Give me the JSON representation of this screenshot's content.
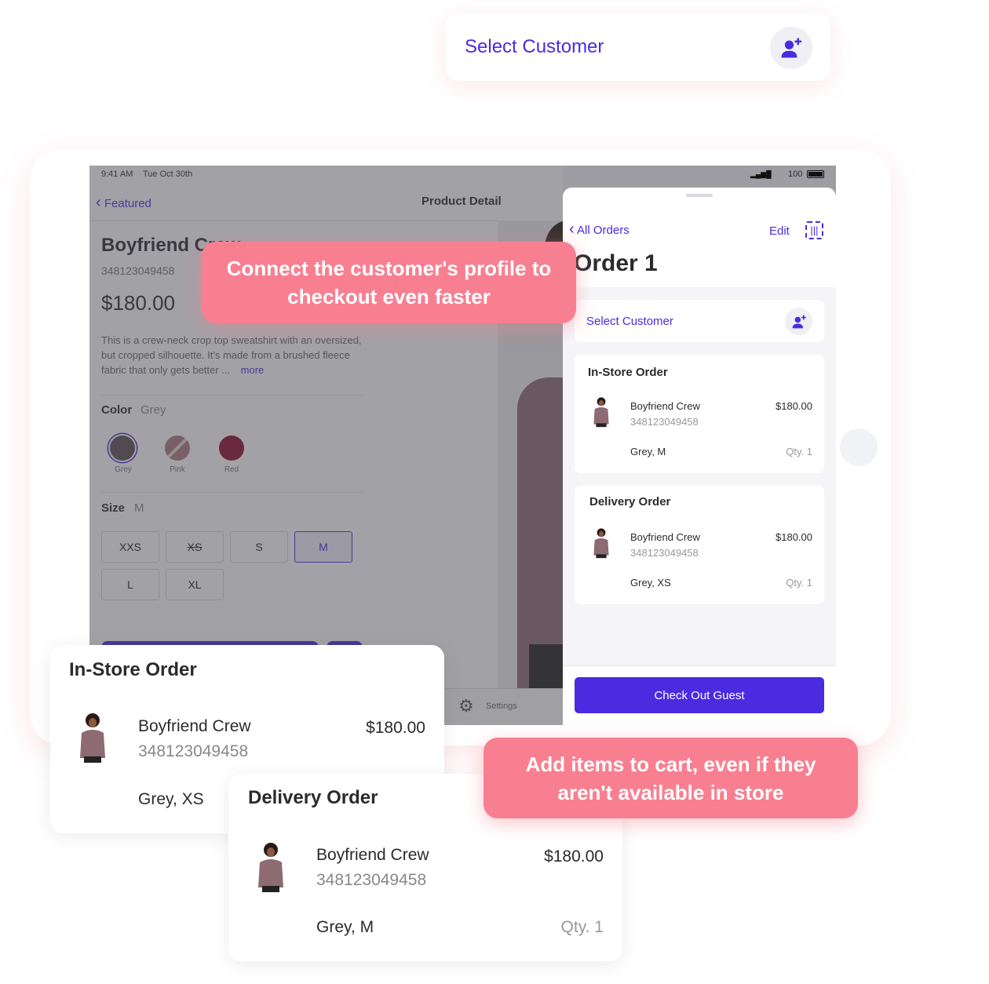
{
  "top_card": {
    "label": "Select Customer",
    "icon": "add-person-icon"
  },
  "status_bar": {
    "time": "9:41 AM",
    "date": "Tue Oct 30th",
    "battery": "100"
  },
  "nav": {
    "back_label": "Featured",
    "title": "Product Detail"
  },
  "product": {
    "name": "Boyfriend Crew",
    "sku": "348123049458",
    "price": "$180.00",
    "description": "This is a crew-neck crop top sweatshirt with an oversized, but cropped silhouette.  It's made from a brushed fleece fabric that only gets better ...",
    "more": "more",
    "color_label": "Color",
    "color_value": "Grey",
    "colors": [
      {
        "name": "Grey",
        "hex": "#5a4f55"
      },
      {
        "name": "Pink",
        "hex": "#b07880"
      },
      {
        "name": "Red",
        "hex": "#8a0f2a"
      }
    ],
    "size_label": "Size",
    "size_value": "M",
    "sizes": [
      "XXS",
      "XS",
      "S",
      "M",
      "L",
      "XL"
    ]
  },
  "tabbar": {
    "settings": "Settings"
  },
  "panel": {
    "back_label": "All Orders",
    "edit": "Edit",
    "title": "Order 1",
    "select_customer": "Select Customer",
    "orders": [
      {
        "title": "In-Store Order",
        "name": "Boyfriend Crew",
        "sku": "348123049458",
        "price": "$180.00",
        "variant": "Grey, M",
        "qty": "Qty. 1"
      },
      {
        "title": "Delivery Order",
        "name": "Boyfriend Crew",
        "sku": "348123049458",
        "price": "$180.00",
        "variant": "Grey, XS",
        "qty": "Qty. 1"
      }
    ],
    "checkout": "Check Out Guest"
  },
  "callouts": [
    "Connect the customer's profile to checkout even faster",
    "Add items to cart, even if they aren't available in store"
  ],
  "instore_card": {
    "title": "In-Store Order",
    "name": "Boyfriend Crew",
    "sku": "348123049458",
    "price": "$180.00",
    "variant": "Grey, XS"
  },
  "delivery_card": {
    "title": "Delivery Order",
    "name": "Boyfriend Crew",
    "sku": "348123049458",
    "price": "$180.00",
    "variant": "Grey, M",
    "qty": "Qty. 1"
  },
  "colors": {
    "accent": "#4a2be0",
    "callout": "#f87f90"
  }
}
